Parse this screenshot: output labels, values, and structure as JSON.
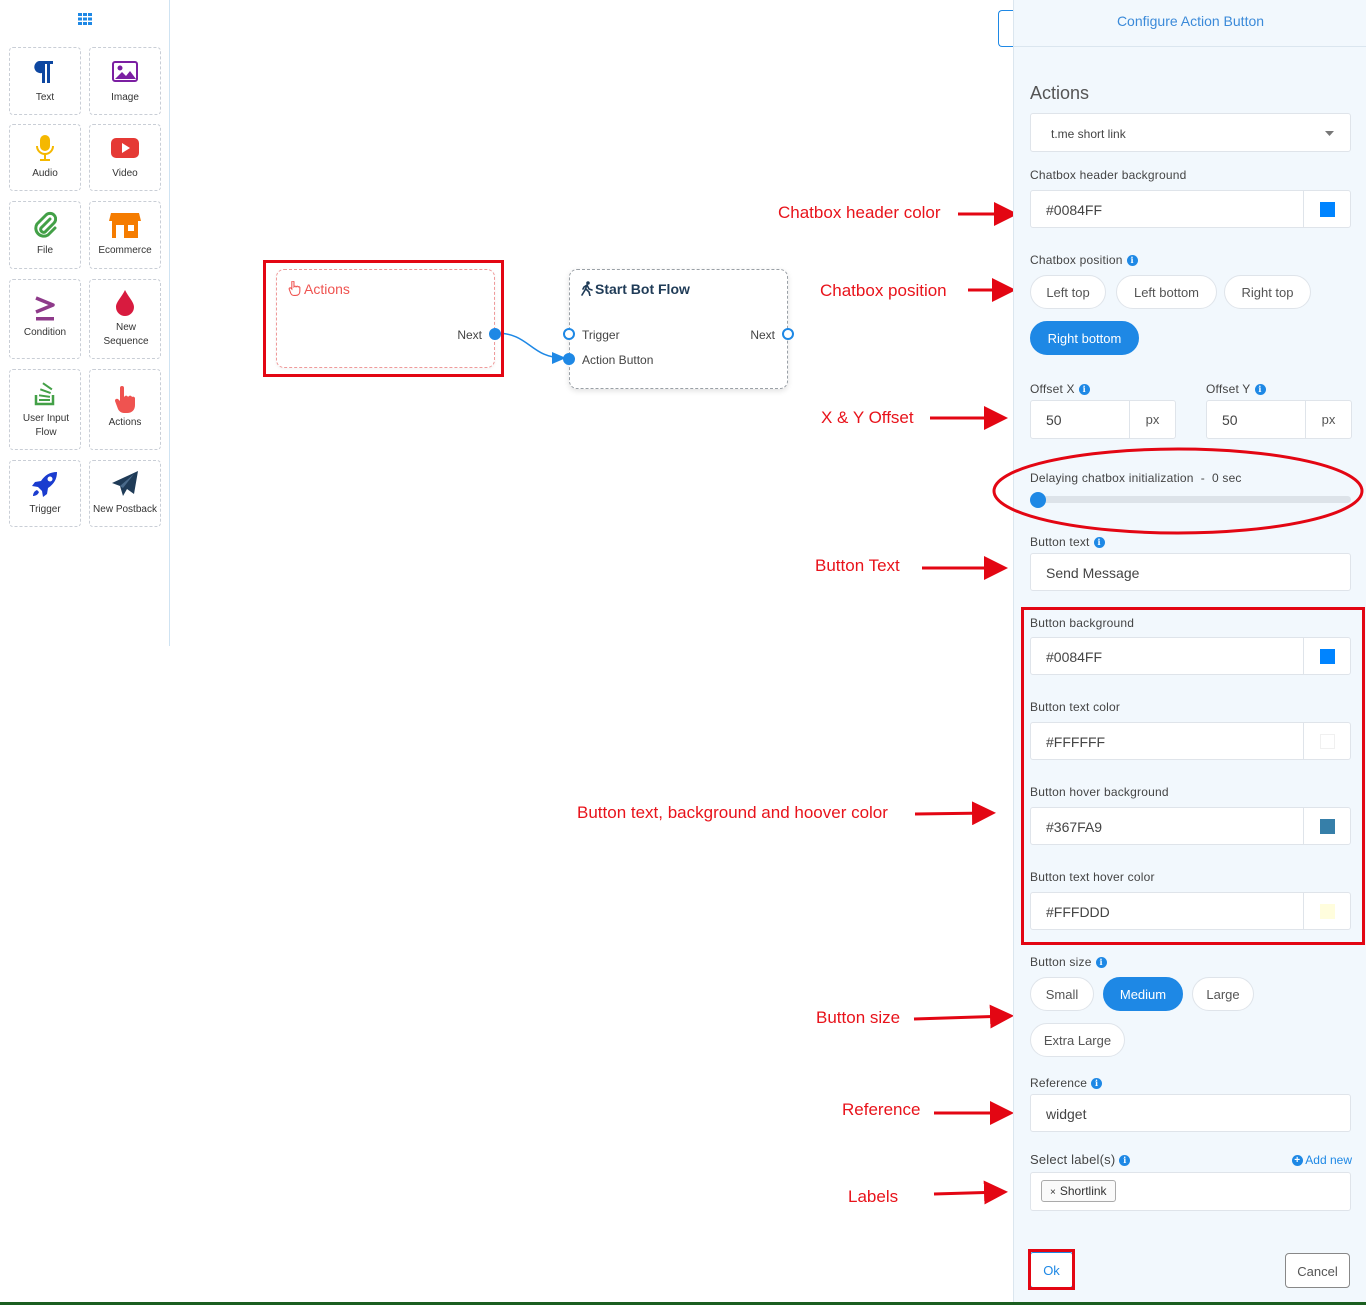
{
  "sidebar": {
    "tiles": [
      {
        "label": "Text",
        "icon": "paragraph-icon"
      },
      {
        "label": "Image",
        "icon": "image-icon"
      },
      {
        "label": "Audio",
        "icon": "microphone-icon"
      },
      {
        "label": "Video",
        "icon": "youtube-icon"
      },
      {
        "label": "File",
        "icon": "paperclip-icon"
      },
      {
        "label": "Ecommerce",
        "icon": "store-icon"
      },
      {
        "label": "Condition",
        "icon": "greater-equal-icon"
      },
      {
        "label": "New Sequence",
        "icon": "drop-icon"
      },
      {
        "label": "User Input Flow",
        "icon": "stack-overflow-icon"
      },
      {
        "label": "Actions",
        "icon": "hand-pointer-icon"
      },
      {
        "label": "Trigger",
        "icon": "rocket-icon"
      },
      {
        "label": "New Postback",
        "icon": "paper-plane-icon"
      }
    ]
  },
  "canvas": {
    "actions_node": {
      "title": "Actions",
      "out_label": "Next"
    },
    "start_node": {
      "title": "Start Bot Flow",
      "in1": "Trigger",
      "in2": "Action Button",
      "out_label": "Next"
    }
  },
  "panel": {
    "title": "Configure Action Button",
    "actions_heading": "Actions",
    "actions_select": "t.me short link",
    "header_bg_label": "Chatbox header background",
    "header_bg_value": "#0084FF",
    "position_label": "Chatbox position",
    "positions": [
      "Left top",
      "Left bottom",
      "Right top",
      "Right bottom"
    ],
    "position_selected": "Right bottom",
    "offset_x_label": "Offset X",
    "offset_x_value": "50",
    "offset_y_label": "Offset Y",
    "offset_y_value": "50",
    "unit": "px",
    "delay_label": "Delaying chatbox initialization  -  0 sec",
    "delay_value": 0,
    "button_text_label": "Button text",
    "button_text_value": "Send Message",
    "button_bg_label": "Button background",
    "button_bg_value": "#0084FF",
    "button_text_color_label": "Button text color",
    "button_text_color_value": "#FFFFFF",
    "button_hover_bg_label": "Button hover background",
    "button_hover_bg_value": "#367FA9",
    "button_text_hover_label": "Button text hover color",
    "button_text_hover_value": "#FFFDDD",
    "button_size_label": "Button size",
    "sizes": [
      "Small",
      "Medium",
      "Large",
      "Extra Large"
    ],
    "size_selected": "Medium",
    "reference_label": "Reference",
    "reference_value": "widget",
    "labels_label": "Select label(s)",
    "add_new": "Add new",
    "label_tag": "Shortlink",
    "ok": "Ok",
    "cancel": "Cancel"
  },
  "annotations": {
    "header_color": "Chatbox header color",
    "position": "Chatbox position",
    "offset": "X & Y Offset",
    "button_text": "Button Text",
    "button_colors": "Button text, background and hoover color",
    "button_size": "Button size",
    "reference": "Reference",
    "labels": "Labels"
  },
  "colors": {
    "accent": "#1e88e5",
    "annotation": "#e8131b",
    "header_bg": "#0084FF",
    "button_bg": "#0084FF",
    "button_text": "#FFFFFF",
    "button_hover_bg": "#367FA9",
    "button_text_hover": "#FFFDDD"
  }
}
